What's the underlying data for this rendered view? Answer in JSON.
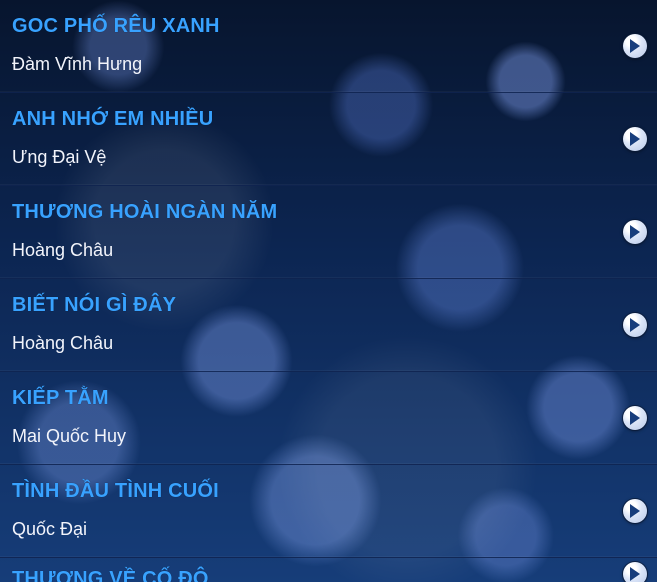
{
  "songs": [
    {
      "title": "GOC PHỐ RÊU XANH",
      "artist": "Đàm Vĩnh Hưng",
      "icon": "play-icon"
    },
    {
      "title": "ANH NHỚ EM NHIỀU",
      "artist": "Ưng Đại Vệ",
      "icon": "play-icon"
    },
    {
      "title": "THƯƠNG HOÀI NGÀN NĂM",
      "artist": "Hoàng Châu",
      "icon": "play-icon"
    },
    {
      "title": "BIẾT NÓI GÌ ĐÂY",
      "artist": "Hoàng Châu",
      "icon": "play-icon"
    },
    {
      "title": "KIẾP TẰM",
      "artist": "Mai Quốc Huy",
      "icon": "play-icon"
    },
    {
      "title": "TÌNH ĐẦU TÌNH CUỐI",
      "artist": "Quốc Đại",
      "icon": "play-icon"
    },
    {
      "title": "THƯƠNG VỀ CỐ ĐÔ",
      "artist": "",
      "icon": "play-icon"
    }
  ],
  "colors": {
    "title": "#38a2ff",
    "artist": "#f2f4fb",
    "background_top": "#07152e",
    "background_bottom": "#163d79"
  }
}
